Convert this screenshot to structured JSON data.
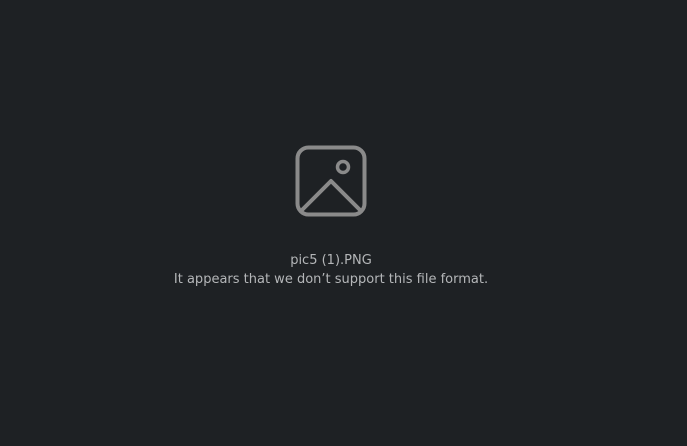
{
  "viewer": {
    "file_name": "pic5 (1).PNG",
    "error_message": "It appears that we don’t support this file format.",
    "icon": "image-placeholder-icon",
    "background_color": "#1e2124",
    "text_color": "#b4b6b8",
    "icon_color": "#8a8a8a"
  }
}
